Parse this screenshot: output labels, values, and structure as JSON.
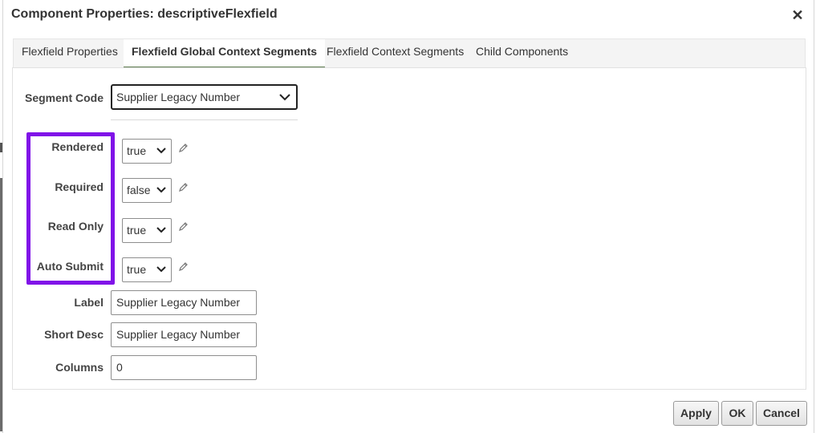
{
  "dialog": {
    "title": "Component Properties: descriptiveFlexfield",
    "close_icon": "close-icon"
  },
  "tabs": [
    {
      "label": "Flexfield Properties",
      "active": false
    },
    {
      "label": "Flexfield Global Context Segments",
      "active": true
    },
    {
      "label": "Flexfield Context Segments",
      "active": false
    },
    {
      "label": "Child Components",
      "active": false
    }
  ],
  "segment_code": {
    "label": "Segment Code",
    "value": "Supplier Legacy Number",
    "icon": "chevron-down-icon"
  },
  "properties": [
    {
      "label": "Rendered",
      "value": "true",
      "icon": "pencil-icon"
    },
    {
      "label": "Required",
      "value": "false",
      "icon": "pencil-icon"
    },
    {
      "label": "Read Only",
      "value": "true",
      "icon": "pencil-icon"
    },
    {
      "label": "Auto Submit",
      "value": "true",
      "icon": "pencil-icon"
    }
  ],
  "text_fields": [
    {
      "label": "Label",
      "value": "Supplier Legacy Number"
    },
    {
      "label": "Short Desc",
      "value": "Supplier Legacy Number"
    },
    {
      "label": "Columns",
      "value": "0"
    }
  ],
  "highlight_color": "#8013e8",
  "active_tab_underline_color": "#5c7a4e",
  "buttons": {
    "apply": "Apply",
    "ok": "OK",
    "cancel": "Cancel"
  }
}
